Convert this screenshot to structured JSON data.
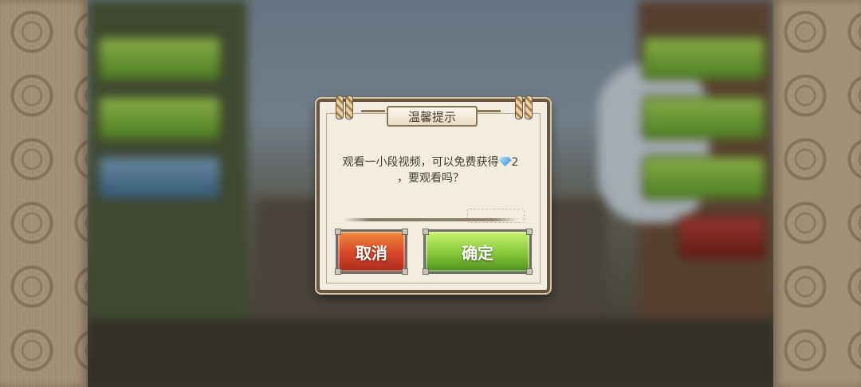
{
  "dialog": {
    "title": "温馨提示",
    "message_line1": "观看一小段视频，可以免费获得",
    "reward_icon": "diamond-gem-icon",
    "reward_amount": "2",
    "message_line2": "，要观看吗？",
    "cancel_label": "取消",
    "confirm_label": "确定"
  },
  "colors": {
    "cancel_button": "#d6452a",
    "confirm_button": "#86c83a",
    "dialog_background": "#f3ece0",
    "dialog_border": "#6a5640"
  }
}
